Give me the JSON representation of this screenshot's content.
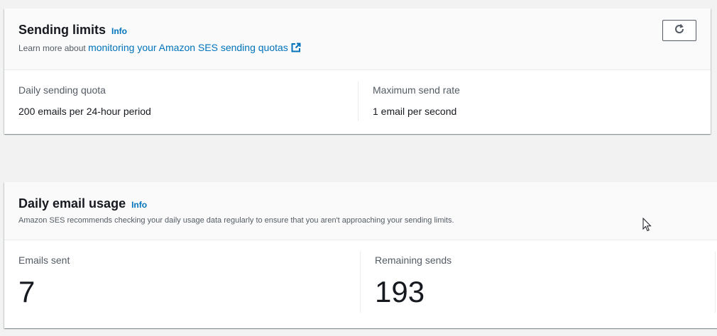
{
  "sending_limits": {
    "title": "Sending limits",
    "info": "Info",
    "desc_prefix": "Learn more about ",
    "desc_link": "monitoring your Amazon SES sending quotas",
    "refresh_icon": "refresh-icon",
    "external_icon": "external-link-icon",
    "daily_quota": {
      "label": "Daily sending quota",
      "value": "200 emails per 24-hour period"
    },
    "max_rate": {
      "label": "Maximum send rate",
      "value": "1 email per second"
    }
  },
  "daily_usage": {
    "title": "Daily email usage",
    "info": "Info",
    "desc": "Amazon SES recommends checking your daily usage data regularly to ensure that you aren't approaching your sending limits.",
    "emails_sent": {
      "label": "Emails sent",
      "value": "7"
    },
    "remaining": {
      "label": "Remaining sends",
      "value": "193"
    }
  },
  "colors": {
    "link": "#0073bb",
    "text": "#16191f",
    "muted": "#545b64",
    "header_bg": "#fafafa",
    "page_bg": "#f2f2f2"
  }
}
